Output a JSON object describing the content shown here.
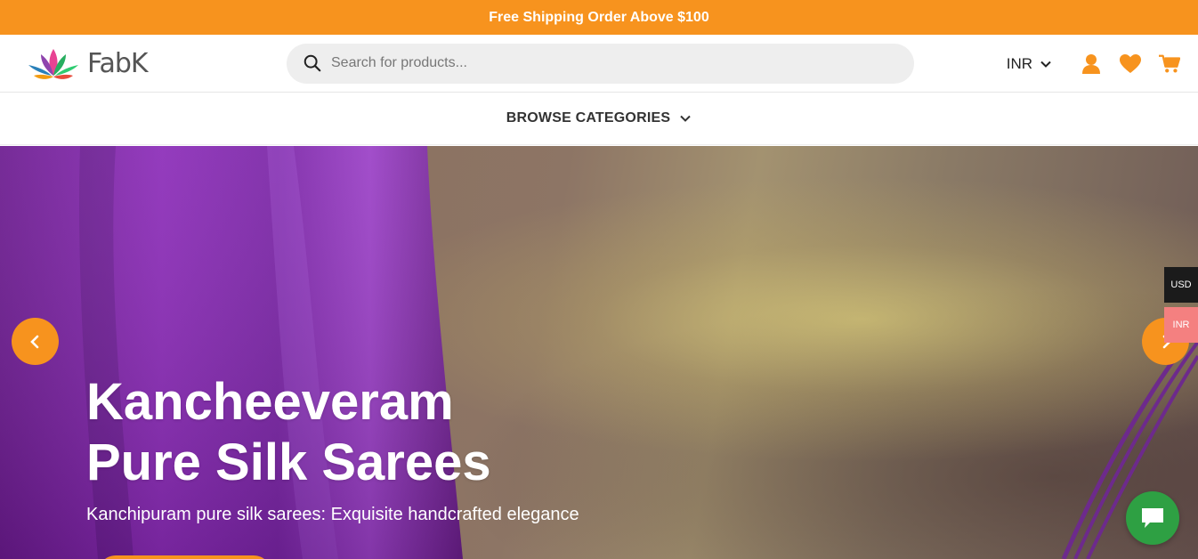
{
  "topbar": {
    "promo_text": "Free Shipping Order Above $100"
  },
  "header": {
    "logo_text": "FabK",
    "search": {
      "placeholder": "Search for products...",
      "value": ""
    },
    "currency": "INR",
    "icons": [
      "user-icon",
      "heart-icon",
      "cart-icon"
    ]
  },
  "nav": {
    "browse_label": "BROWSE CATEGORIES"
  },
  "hero": {
    "title_line1": "Kancheeveram",
    "title_line2": "Pure Silk Sarees",
    "subtitle": "Kanchipuram pure silk sarees: Exquisite handcrafted elegance"
  },
  "currency_switcher": {
    "usd": "USD",
    "inr": "INR"
  },
  "colors": {
    "accent": "#f7931e",
    "chat": "#2ea043",
    "inr_badge": "#f48080",
    "usd_badge": "#1b1b1b"
  }
}
